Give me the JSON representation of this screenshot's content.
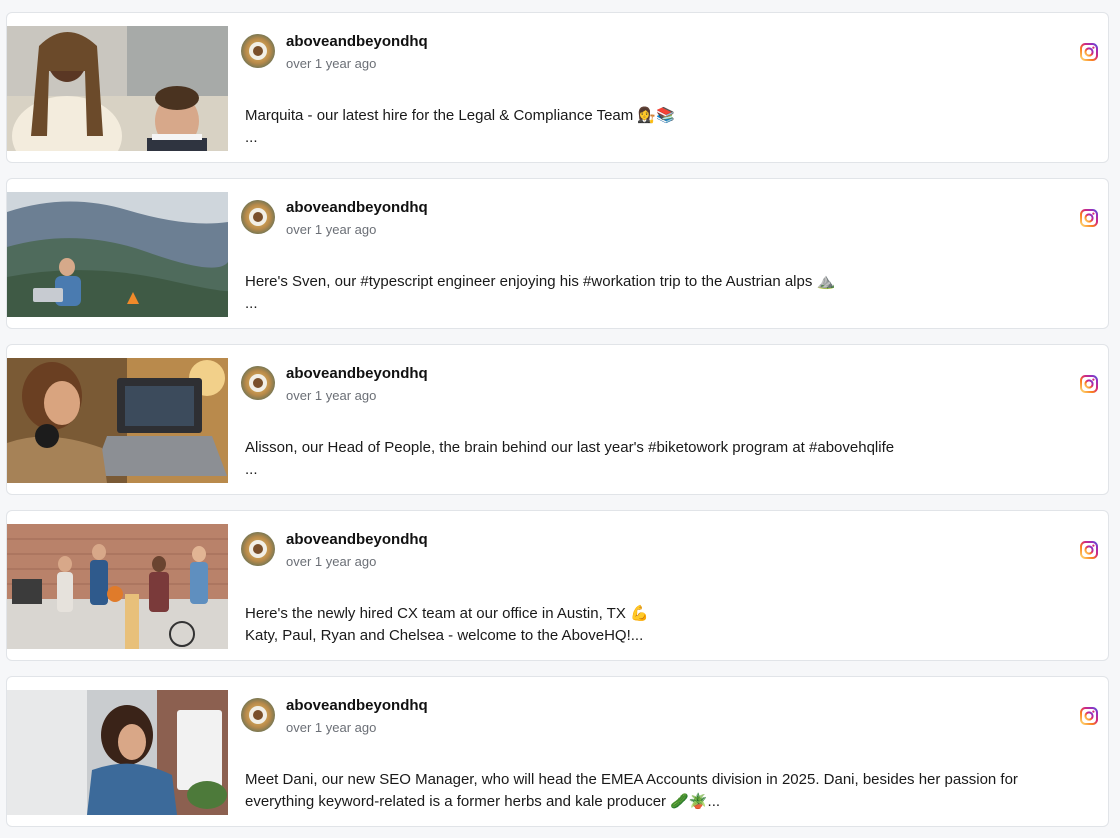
{
  "posts": [
    {
      "username": "aboveandbeyondhq",
      "time": "over 1 year ago",
      "caption_line1": "Marquita - our latest hire for the Legal & Compliance Team 👩‍⚖️📚",
      "caption_line2": "...",
      "image": "woman-in-office-photo",
      "source": "instagram-icon"
    },
    {
      "username": "aboveandbeyondhq",
      "time": "over 1 year ago",
      "caption_line1": "Here's Sven, our #typescript engineer enjoying his #workation trip to the Austrian alps ⛰️",
      "caption_line2": "...",
      "image": "man-with-laptop-in-mountains-photo",
      "source": "instagram-icon"
    },
    {
      "username": "aboveandbeyondhq",
      "time": "over 1 year ago",
      "caption_line1": "Alisson, our Head of People, the brain behind our last year's #biketowork program at #abovehqlife",
      "caption_line2": "...",
      "image": "woman-working-on-laptop-photo",
      "source": "instagram-icon"
    },
    {
      "username": "aboveandbeyondhq",
      "time": "over 1 year ago",
      "caption_line1": "Here's the newly hired CX team at our office in Austin, TX 💪",
      "caption_line2": "Katy, Paul, Ryan and Chelsea - welcome to the AboveHQ!...",
      "image": "team-in-office-photo",
      "source": "instagram-icon"
    },
    {
      "username": "aboveandbeyondhq",
      "time": "over 1 year ago",
      "caption_line1": "Meet Dani, our new SEO Manager, who will head the EMEA Accounts division in 2025. Dani, besides her passion for",
      "caption_line2": "everything keyword-related is a former herbs and kale producer 🥒🪴...",
      "image": "woman-at-computer-photo",
      "source": "instagram-icon"
    }
  ],
  "colors": {
    "page_background": "#f6f7f9",
    "card_background": "#ffffff",
    "card_border": "#e1e4e8",
    "text_primary": "#111111",
    "text_secondary": "#6b6f76"
  }
}
